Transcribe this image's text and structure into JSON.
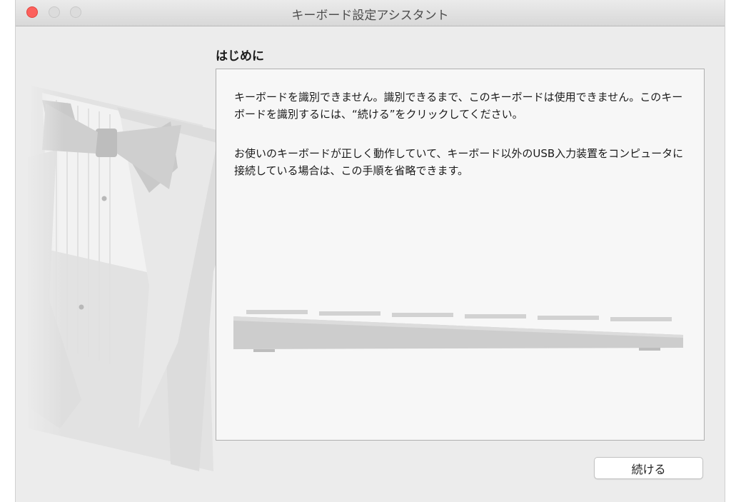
{
  "window": {
    "title": "キーボード設定アシスタント"
  },
  "page": {
    "heading": "はじめに",
    "paragraphs": [
      "キーボードを識別できません。識別できるまで、このキーボードは使用できません。このキーボードを識別するには、“続ける”をクリックしてください。",
      "お使いのキーボードが正しく動作していて、キーボード以外のUSB入力装置をコンピュータに接続している場合は、この手順を省略できます。"
    ]
  },
  "buttons": {
    "continue_label": "続ける"
  },
  "colors": {
    "close": "#fc605c",
    "inactive_traffic": "#dcdcdc",
    "window_bg": "#ececec"
  },
  "icons": [
    "tuxedo-illustration",
    "keyboard-illustration"
  ]
}
